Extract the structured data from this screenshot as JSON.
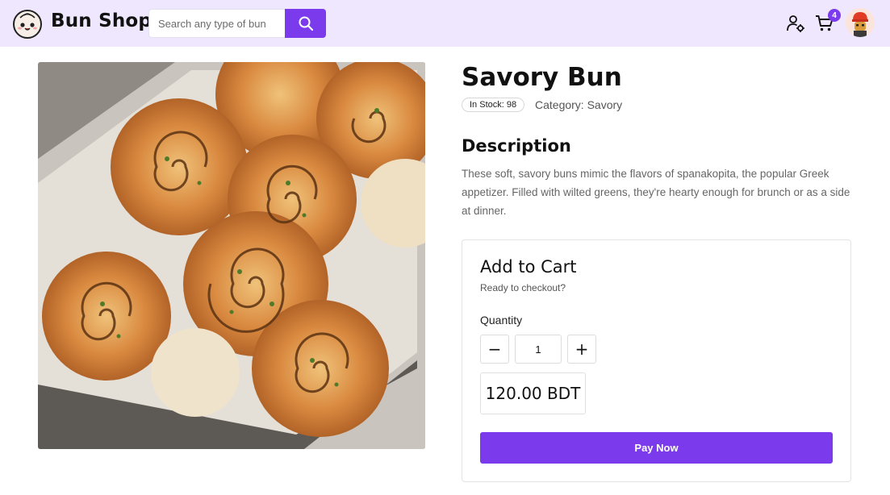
{
  "header": {
    "brand": "Bun Shop",
    "logo_icon": "bun-face-logo-icon",
    "search": {
      "placeholder": "Search any type of bun",
      "value": "",
      "button_icon": "search-icon"
    },
    "user_icon": "user-settings-icon",
    "cart": {
      "icon": "cart-icon",
      "count": "4"
    },
    "avatar_icon": "avatar-icon"
  },
  "product": {
    "image_alt": "product-photo",
    "title": "Savory Bun",
    "stock": "In Stock: 98",
    "category": "Category: Savory",
    "description_heading": "Description",
    "description": "These soft, savory buns mimic the flavors of spanakopita, the popular Greek appetizer. Filled with wilted greens, they're hearty enough for brunch or as a side at dinner."
  },
  "cart_card": {
    "title": "Add to Cart",
    "subtitle": "Ready to checkout?",
    "quantity_label": "Quantity",
    "minus_label": "−",
    "plus_label": "+",
    "quantity_value": "1",
    "price": "120.00 BDT",
    "pay_label": "Pay Now"
  },
  "colors": {
    "accent": "#7c3aed",
    "header_bg": "#efe7fd"
  }
}
